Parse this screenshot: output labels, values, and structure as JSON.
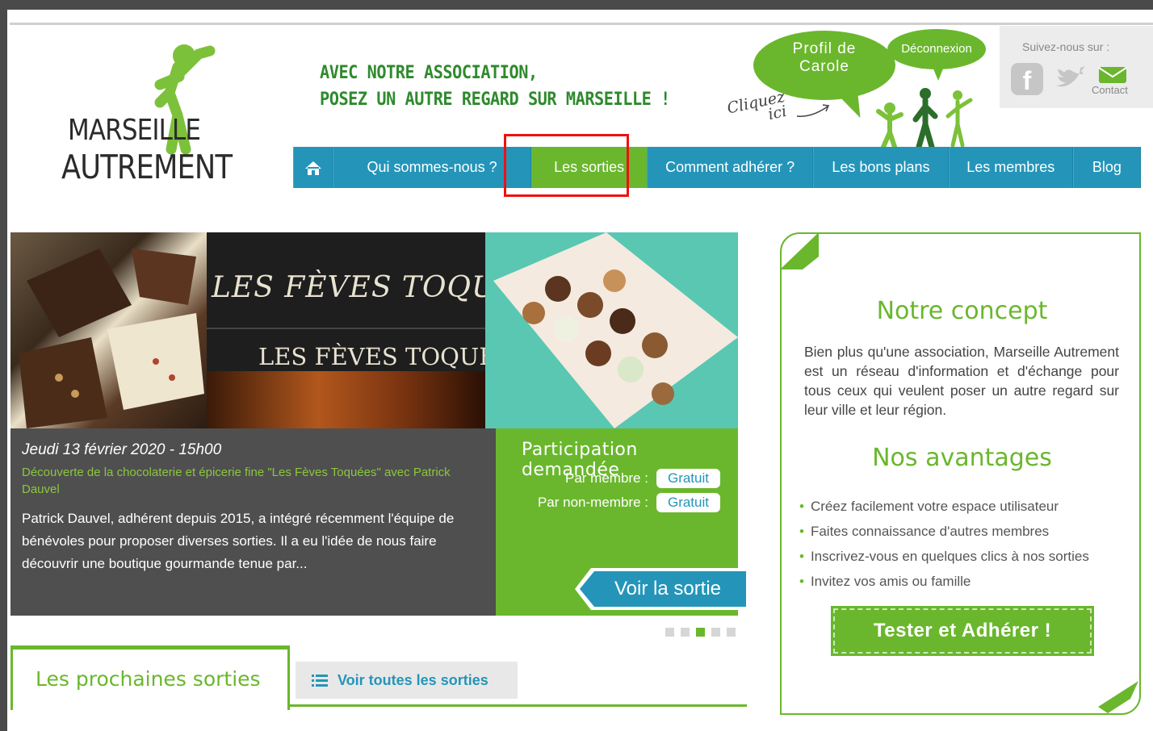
{
  "logo": {
    "line1": "MARSEILLE",
    "line2": "AUTREMENT"
  },
  "header": {
    "slogan_line1": "AVEC NOTRE ASSOCIATION,",
    "slogan_line2": "POSEZ UN AUTRE REGARD SUR MARSEILLE !",
    "profile_line1": "Profil de",
    "profile_line2": "Carole",
    "logout_label": "Déconnexion",
    "cliquez_line1": "Cliquez",
    "cliquez_line2": "ici"
  },
  "social": {
    "title": "Suivez-nous sur :",
    "contact_label": "Contact",
    "icons": [
      "facebook-icon",
      "twitter-icon",
      "mail-icon"
    ]
  },
  "nav": {
    "home_icon": "home-icon",
    "items": [
      "Qui sommes-nous ?",
      "Les sorties",
      "Comment adhérer ?",
      "Les bons plans",
      "Les membres",
      "Blog"
    ],
    "active": "Les sorties"
  },
  "slider": {
    "shop_title": "LES FÈVES TOQUÉES",
    "shop_sign": "LES FÈVES TOQUÉES",
    "date": "Jeudi 13 février 2020 - 15h00",
    "subtitle": "Découverte de la chocolaterie et épicerie fine \"Les Fèves Toquées\" avec Patrick Dauvel",
    "description": "Patrick Dauvel, adhérent depuis 2015, a intégré récemment l'équipe de bénévoles pour proposer diverses sorties. Il a eu l'idée de nous faire découvrir une boutique gourmande tenue par...",
    "participation_title": "Participation demandée",
    "member_label": "Par membre :",
    "member_price": "Gratuit",
    "nonmember_label": "Par non-membre :",
    "nonmember_price": "Gratuit",
    "cta": "Voir la sortie",
    "dots_count": 5,
    "active_dot": 3
  },
  "tabs": {
    "next_label": "Les prochaines sorties",
    "all_label": "Voir toutes les sorties"
  },
  "concept": {
    "title": "Notre concept",
    "text": "Bien plus qu'une association, Marseille Autrement est un réseau d'information et d'échange pour tous ceux qui veulent poser un autre regard sur leur ville et leur région.",
    "advantages_title": "Nos avantages",
    "advantages": [
      "Créez facilement votre espace utilisateur",
      "Faites connaissance d'autres membres",
      "Inscrivez-vous en quelques clics à nos sorties",
      "Invitez vos amis ou famille"
    ],
    "cta": "Tester et Adhérer !"
  },
  "colors": {
    "green": "#6ab72d",
    "blue": "#2495b9",
    "dark": "#4f4f4f"
  }
}
